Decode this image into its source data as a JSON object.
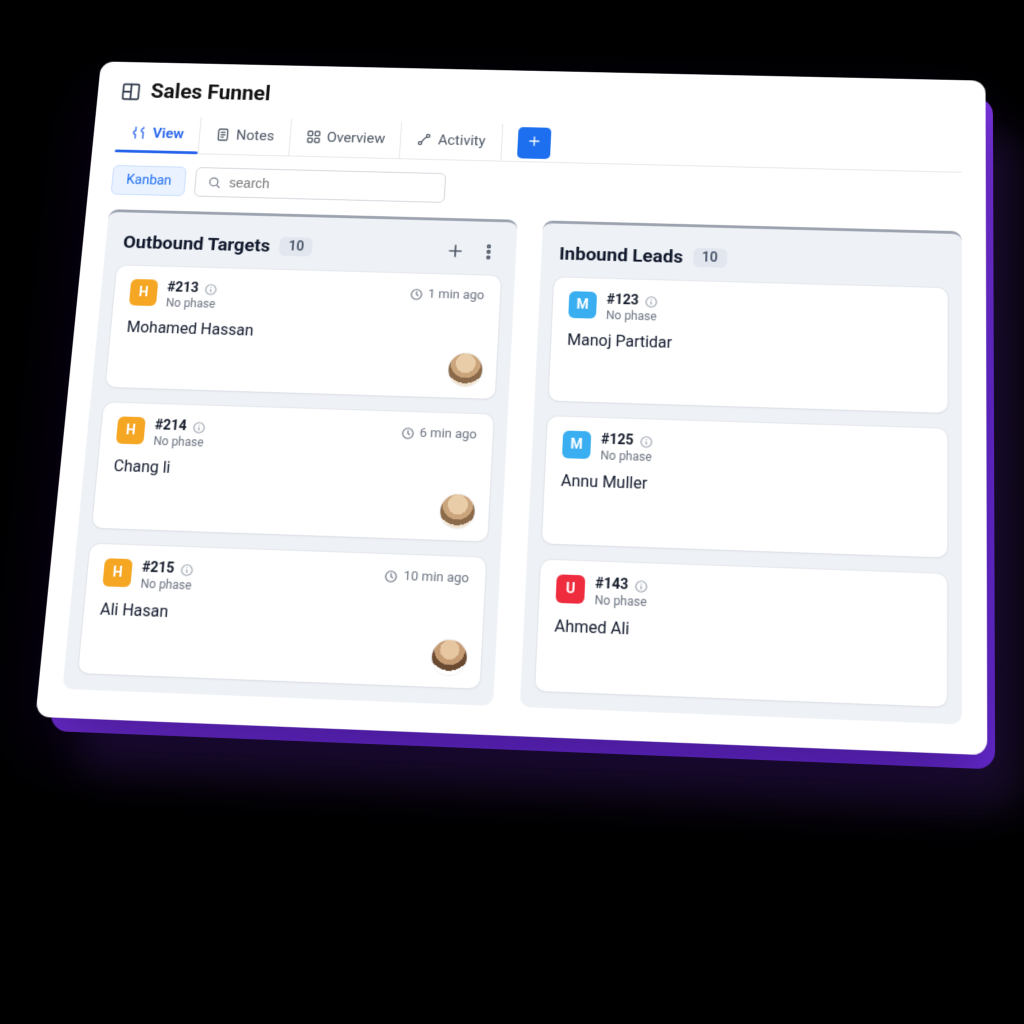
{
  "header": {
    "title": "Sales Funnel"
  },
  "tabs": [
    {
      "label": "View"
    },
    {
      "label": "Notes"
    },
    {
      "label": "Overview"
    },
    {
      "label": "Activity"
    }
  ],
  "toolbar": {
    "view_mode": "Kanban",
    "search_placeholder": "search"
  },
  "columns": [
    {
      "title": "Outbound Targets",
      "count": "10",
      "cards": [
        {
          "initial": "H",
          "initialColor": "amber",
          "id": "#213",
          "phase": "No phase",
          "time": "1 min ago",
          "name": "Mohamed Hassan",
          "avatar": "a"
        },
        {
          "initial": "H",
          "initialColor": "amber",
          "id": "#214",
          "phase": "No phase",
          "time": "6 min ago",
          "name": "Chang li",
          "avatar": "a"
        },
        {
          "initial": "H",
          "initialColor": "amber",
          "id": "#215",
          "phase": "No phase",
          "time": "10 min ago",
          "name": "Ali Hasan",
          "avatar": "b"
        }
      ]
    },
    {
      "title": "Inbound Leads",
      "count": "10",
      "cards": [
        {
          "initial": "M",
          "initialColor": "sky",
          "id": "#123",
          "phase": "No phase",
          "name": "Manoj Partidar"
        },
        {
          "initial": "M",
          "initialColor": "sky",
          "id": "#125",
          "phase": "No phase",
          "name": "Annu Muller"
        },
        {
          "initial": "U",
          "initialColor": "red",
          "id": "#143",
          "phase": "No phase",
          "name": "Ahmed Ali"
        }
      ]
    }
  ]
}
